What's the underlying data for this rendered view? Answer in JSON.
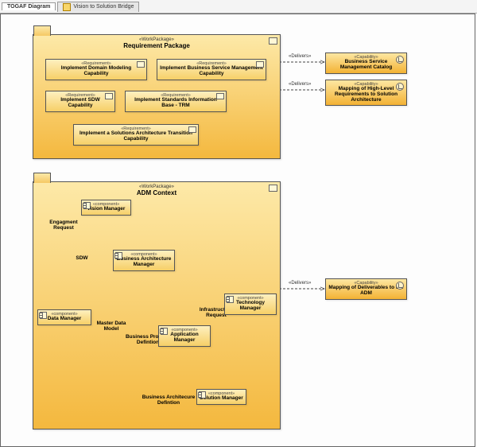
{
  "tabs": {
    "t0": "TOGAF Diagram",
    "t1": "Vision to Solution Bridge"
  },
  "packages": {
    "req": {
      "stereo": "«WorkPackage»",
      "title": "Requirement Package"
    },
    "adm": {
      "stereo": "«WorkPackage»",
      "title": "ADM Context"
    }
  },
  "reqs": {
    "r1": {
      "stereo": "«Requirement»",
      "name": "Implement Domain Modeling Capability"
    },
    "r2": {
      "stereo": "«Requirement»",
      "name": "Implement Business Service Management Capability"
    },
    "r3": {
      "stereo": "«Requirement»",
      "name": "Implement  SDW Capability"
    },
    "r4": {
      "stereo": "«Requirement»",
      "name": "Implement Standards Information Base - TRM"
    },
    "r5": {
      "stereo": "«Requirement»",
      "name": "Implement a Solutions Architecture Transition Capability"
    }
  },
  "admNodes": {
    "vision": {
      "stereo": "«component»",
      "name": "Vision Manager"
    },
    "engage": {
      "name": "Engagment Request"
    },
    "sdw": {
      "name": "SDW"
    },
    "bam": {
      "stereo": "«component»",
      "name": "Business Architecture Manager"
    },
    "dmgr": {
      "stereo": "«component»",
      "name": "Data Manager"
    },
    "mdm": {
      "name": "Master Data Model"
    },
    "bpd": {
      "name": "Business Process Defintion"
    },
    "appmgr": {
      "stereo": "«component»",
      "name": "Application Manager"
    },
    "infra": {
      "name": "Infrastructure Request"
    },
    "tech": {
      "stereo": "«component»",
      "name": "Technology Manager"
    },
    "bacd": {
      "name": "Business Architecure Defintion"
    },
    "sol": {
      "stereo": "«component»",
      "name": "Solution Manager"
    }
  },
  "caps": {
    "c1": {
      "stereo": "«Capability»",
      "name": "Business Service Management Catalog"
    },
    "c2": {
      "stereo": "«Capability»",
      "name": "Mapping of High-Level Requirements to Solution Architecture"
    },
    "c3": {
      "stereo": "«Capability»",
      "name": "Mapping of Deliverables to the ADM"
    }
  },
  "edgeLabels": {
    "delivers": "«Delivers»"
  },
  "colors": {
    "accent": "#f4b83e"
  }
}
